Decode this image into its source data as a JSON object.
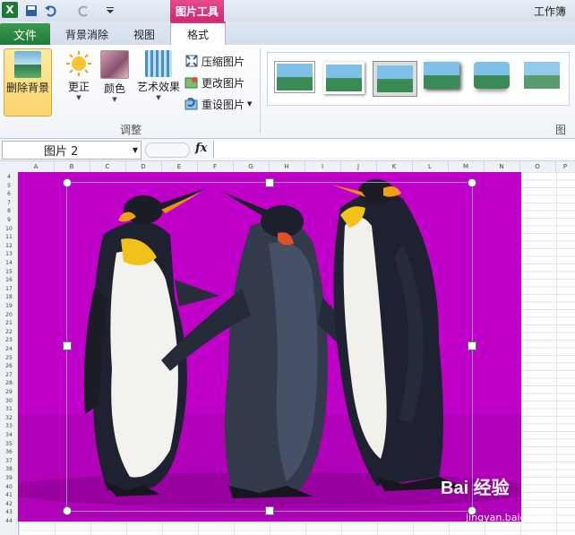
{
  "window": {
    "title": "工作簿"
  },
  "context_tab": {
    "label": "图片工具"
  },
  "tabs": [
    {
      "label": "文件"
    },
    {
      "label": "背景消除"
    },
    {
      "label": "视图"
    },
    {
      "label": "格式"
    }
  ],
  "ribbon": {
    "remove_background": "删除背景",
    "corrections": "更正",
    "color": "颜色",
    "artistic_effects": "艺术效果",
    "compress": "压缩图片",
    "change": "更改图片",
    "reset": "重设图片",
    "adjust_group": "调整",
    "styles_group": "图片"
  },
  "formula_bar": {
    "name_box": "图片  2",
    "fx": "fx"
  },
  "columns": [
    "A",
    "B",
    "C",
    "D",
    "E",
    "F",
    "G",
    "H",
    "I",
    "J",
    "K",
    "L",
    "M",
    "N",
    "O",
    "P"
  ],
  "rows": [
    "4",
    "5",
    "6",
    "7",
    "8",
    "9",
    "10",
    "11",
    "12",
    "13",
    "14",
    "15",
    "16",
    "17",
    "18",
    "19",
    "20",
    "21",
    "22",
    "23",
    "24",
    "25",
    "26",
    "27",
    "28",
    "29",
    "30",
    "31",
    "32",
    "33",
    "34",
    "35",
    "36",
    "37",
    "38",
    "39",
    "40",
    "41",
    "42",
    "43",
    "44"
  ],
  "watermark": {
    "brand": "Bai 经验",
    "url": "jingyan.baidu.com"
  },
  "colors": {
    "picture_background": "#c000c8",
    "file_tab": "#1f7a3a",
    "context_tab": "#d2367f"
  }
}
